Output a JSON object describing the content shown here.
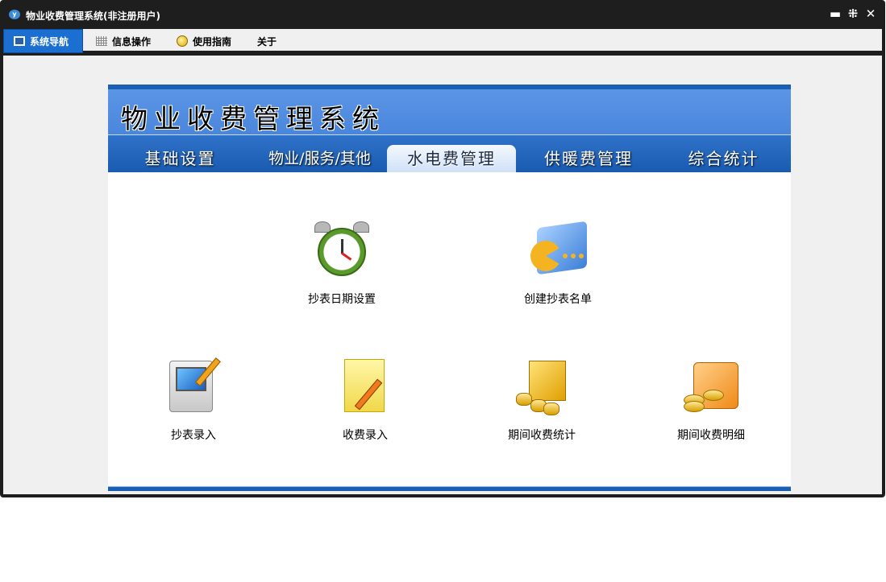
{
  "window": {
    "title": "物业收费管理系统(非注册用户)",
    "controls": {
      "minimize": "▬",
      "restore": "⁜",
      "close": "✕"
    }
  },
  "menubar": {
    "tabs": [
      {
        "label": "系统导航",
        "icon": "monitor-icon",
        "active": true
      },
      {
        "label": "信息操作",
        "icon": "grid-icon",
        "active": false
      },
      {
        "label": "使用指南",
        "icon": "help-circle-icon",
        "active": false
      },
      {
        "label": "关于",
        "icon": "",
        "active": false
      }
    ]
  },
  "panel": {
    "system_title": "物业收费管理系统",
    "nav_tabs": [
      {
        "label": "基础设置",
        "active": false
      },
      {
        "label": "物业/服务/其他",
        "active": false
      },
      {
        "label": "水电费管理",
        "active": true
      },
      {
        "label": "供暖费管理",
        "active": false
      },
      {
        "label": "综合统计",
        "active": false
      }
    ],
    "functions": [
      {
        "label": "抄表日期设置",
        "icon": "alarm-clock-icon"
      },
      {
        "label": "创建抄表名单",
        "icon": "pie-folder-icon"
      },
      {
        "label": "抄表录入",
        "icon": "computer-pen-icon"
      },
      {
        "label": "收费录入",
        "icon": "notepad-pen-icon"
      },
      {
        "label": "期间收费统计",
        "icon": "coins-box-icon"
      },
      {
        "label": "期间收费明细",
        "icon": "coins-folder-icon"
      }
    ]
  },
  "colors": {
    "titlebar": "#1e1e1e",
    "accent_blue": "#1a5fb4",
    "banner_blue": "#5b95e6",
    "active_menu": "#1b6fd0"
  }
}
